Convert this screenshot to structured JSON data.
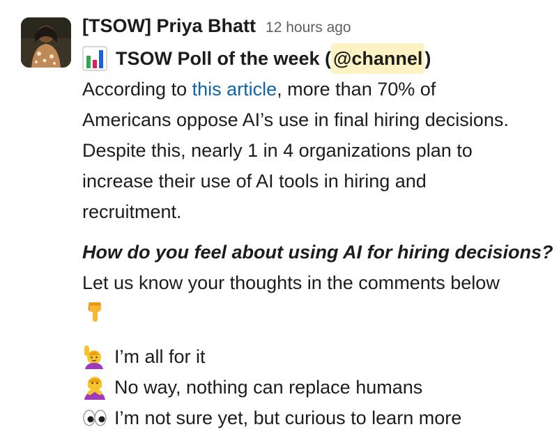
{
  "message": {
    "sender": "[TSOW] Priya Bhatt",
    "timestamp": "12 hours ago",
    "title_prefix": "TSOW Poll of the week (",
    "mention": "@channel",
    "title_suffix": ")",
    "paragraph_intro": "According to ",
    "link_text": "this article",
    "paragraph_lines": [
      ", more than 70% of",
      "Americans oppose AI’s use in final hiring decisions.",
      "Despite this, nearly 1 in 4 organizations plan to",
      "increase their use of AI tools in hiring and",
      "recruitment."
    ],
    "question": "How do you feel about using AI for hiring decisions?",
    "cta": "Let us know your thoughts in the comments below",
    "options": [
      {
        "icon": "raising-hand-icon",
        "label": "I’m all for it"
      },
      {
        "icon": "no-gesture-icon",
        "label": "No way, nothing can replace humans"
      },
      {
        "icon": "eyes-icon",
        "label": "I’m not sure yet, but curious to learn more"
      }
    ]
  },
  "colors": {
    "link": "#1264a3",
    "mention_bg": "#fdf2c4",
    "timestamp": "#616061",
    "text": "#1d1c1d"
  },
  "icons": {
    "avatar": "user-avatar",
    "title": "bar-chart-icon",
    "cta": "pointing-down-icon"
  }
}
